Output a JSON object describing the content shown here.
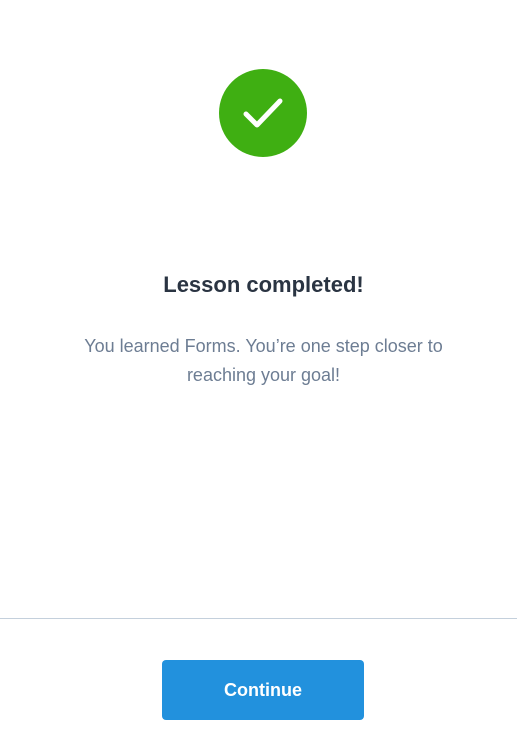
{
  "completion": {
    "icon": "checkmark-icon",
    "icon_color": "#3faf12",
    "title": "Lesson completed!",
    "message": "You learned Forms. You’re one step closer to reaching your goal!"
  },
  "footer": {
    "continue_label": "Continue",
    "button_color": "#2291dd"
  }
}
